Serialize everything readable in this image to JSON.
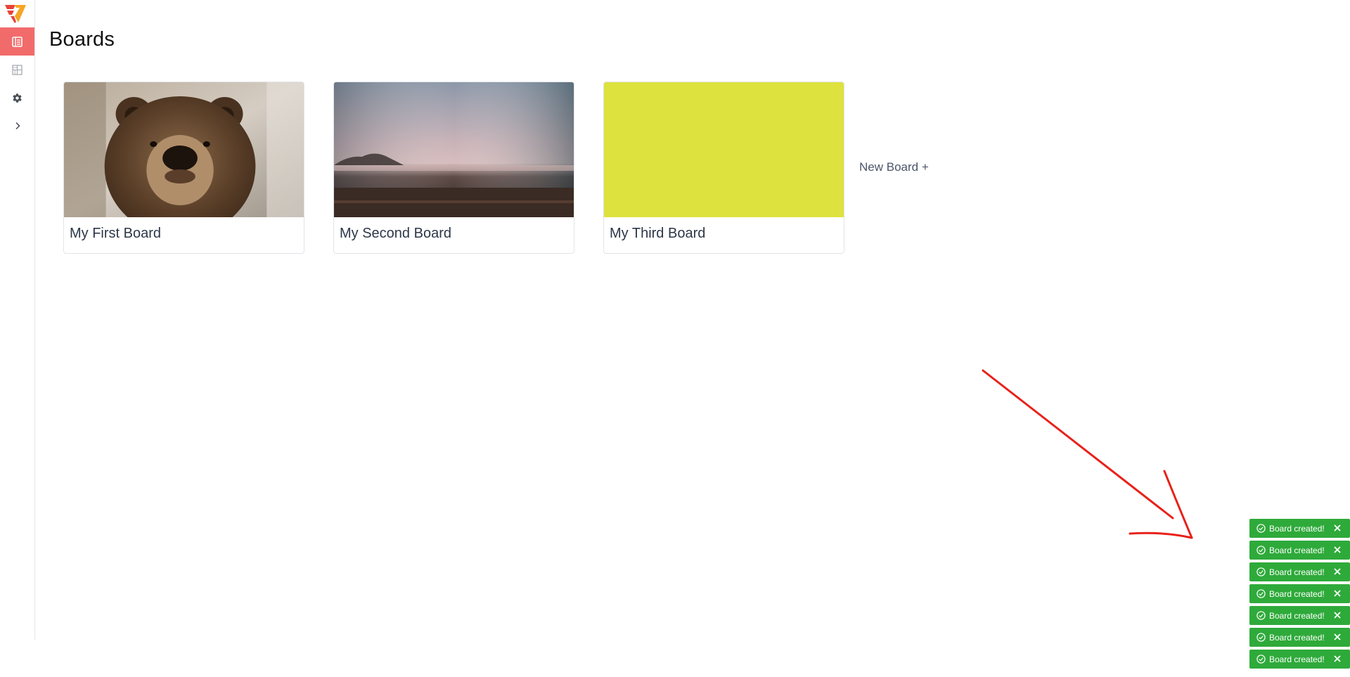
{
  "sidebar": {
    "items": [
      {
        "icon": "boards-list-icon",
        "active": true
      },
      {
        "icon": "grid-icon",
        "active": false
      },
      {
        "icon": "gear-icon",
        "active": false
      },
      {
        "icon": "chevron-right-icon",
        "active": false
      }
    ]
  },
  "header": {
    "title": "Boards"
  },
  "boards": [
    {
      "title": "My First Board",
      "cover": "bear-photo"
    },
    {
      "title": "My Second Board",
      "cover": "foggy-field-photo"
    },
    {
      "title": "My Third Board",
      "cover": "solid-color",
      "cover_color": "#dde23f"
    }
  ],
  "new_board_label": "New Board +",
  "toasts": [
    {
      "text": "Board created!"
    },
    {
      "text": "Board created!"
    },
    {
      "text": "Board created!"
    },
    {
      "text": "Board created!"
    },
    {
      "text": "Board created!"
    },
    {
      "text": "Board created!"
    },
    {
      "text": "Board created!"
    }
  ],
  "colors": {
    "accent": "#f26b6b",
    "toast": "#2eaa3a",
    "annotation": "#e8211a"
  }
}
